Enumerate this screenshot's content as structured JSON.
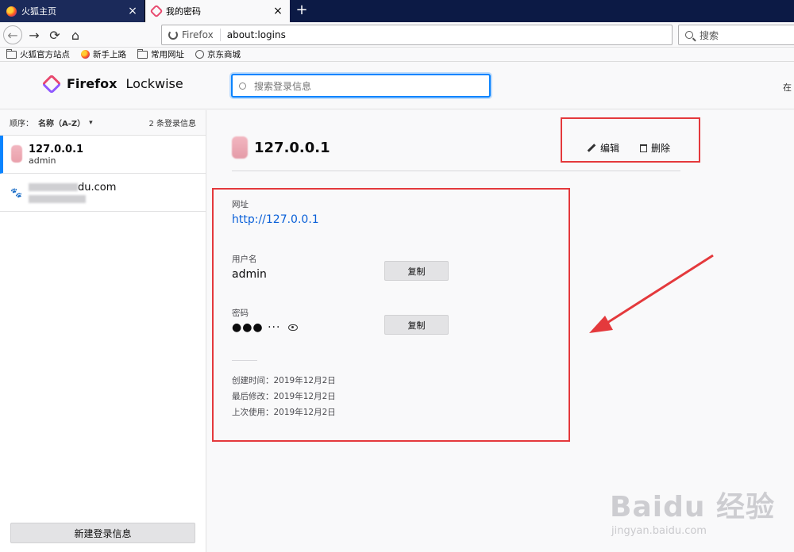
{
  "tabs": [
    {
      "title": "火狐主页",
      "close": "×"
    },
    {
      "title": "我的密码",
      "close": "×"
    }
  ],
  "new_tab_label": "+",
  "nav": {
    "back": "←",
    "forward": "→",
    "reload": "⟳",
    "home": "⌂"
  },
  "urlbar": {
    "identity": "Firefox",
    "url": "about:logins"
  },
  "searchbar": {
    "placeholder": "搜索"
  },
  "bookmarks": [
    "火狐官方站点",
    "新手上路",
    "常用网址",
    "京东商城"
  ],
  "app": {
    "brand_bold": "Firefox",
    "brand_rest": " Lockwise",
    "filter_placeholder": "搜索登录信息",
    "header_right": "在"
  },
  "sidebar": {
    "sort_label": "顺序：",
    "sort_value": "名称（A-Z）",
    "count": "2 条登录信息",
    "items": [
      {
        "title": "127.0.0.1",
        "username": "admin"
      },
      {
        "title_visible": "du.com"
      }
    ],
    "new_login": "新建登录信息"
  },
  "detail": {
    "title": "127.0.0.1",
    "edit": "编辑",
    "delete": "删除",
    "origin_label": "网址",
    "origin_value": "http://127.0.0.1",
    "username_label": "用户名",
    "username_value": "admin",
    "password_label": "密码",
    "password_value": "●●● ···",
    "copy": "复制",
    "created": "创建时间：2019年12月2日",
    "modified": "最后修改：2019年12月2日",
    "used": "上次使用：2019年12月2日"
  },
  "watermark": {
    "main": "Baidu 经验",
    "sub": "jingyan.baidu.com"
  },
  "colors": {
    "accent": "#0a84ff",
    "annotation": "#e4393c",
    "link": "#0a60d8"
  }
}
